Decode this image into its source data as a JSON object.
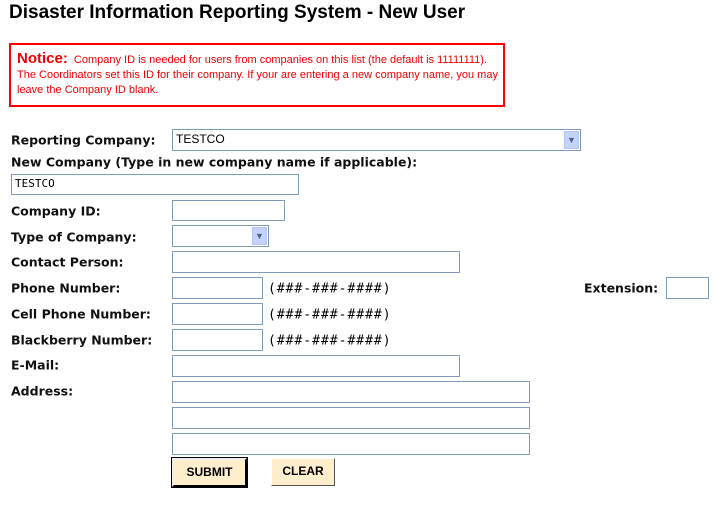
{
  "title": "Disaster Information Reporting System - New User",
  "notice": {
    "label": "Notice:",
    "text": "Company ID is needed for users from companies on this list (the default is 11111111). The Coordinators set this ID for their company. If your are entering a new company name, you may leave the Company ID blank."
  },
  "form": {
    "reporting_company_label": "Reporting Company:",
    "reporting_company_value": "TESTCO",
    "new_company_label": "New Company (Type in new company name if applicable):",
    "new_company_value": "TESTCO",
    "company_id_label": "Company ID:",
    "company_id_value": "",
    "type_label": "Type of Company:",
    "type_value": "",
    "contact_label": "Contact Person:",
    "contact_value": "",
    "phone_label": "Phone Number:",
    "phone_value": "",
    "phone_format": "(###-###-####)",
    "extension_label": "Extension:",
    "extension_value": "",
    "cell_label": "Cell Phone Number:",
    "cell_value": "",
    "cell_format": "(###-###-####)",
    "blackberry_label": "Blackberry Number:",
    "blackberry_value": "",
    "blackberry_format": "(###-###-####)",
    "email_label": "E-Mail:",
    "email_value": "",
    "address_label": "Address:",
    "address1": "",
    "address2": "",
    "address3": "",
    "submit": "SUBMIT",
    "clear": "CLEAR"
  },
  "icons": {
    "select_arrow": "chevron-down-icon"
  },
  "colors": {
    "notice": "#ff0000",
    "button_bg": "#feeecc",
    "input_border": "#7f9db9"
  }
}
